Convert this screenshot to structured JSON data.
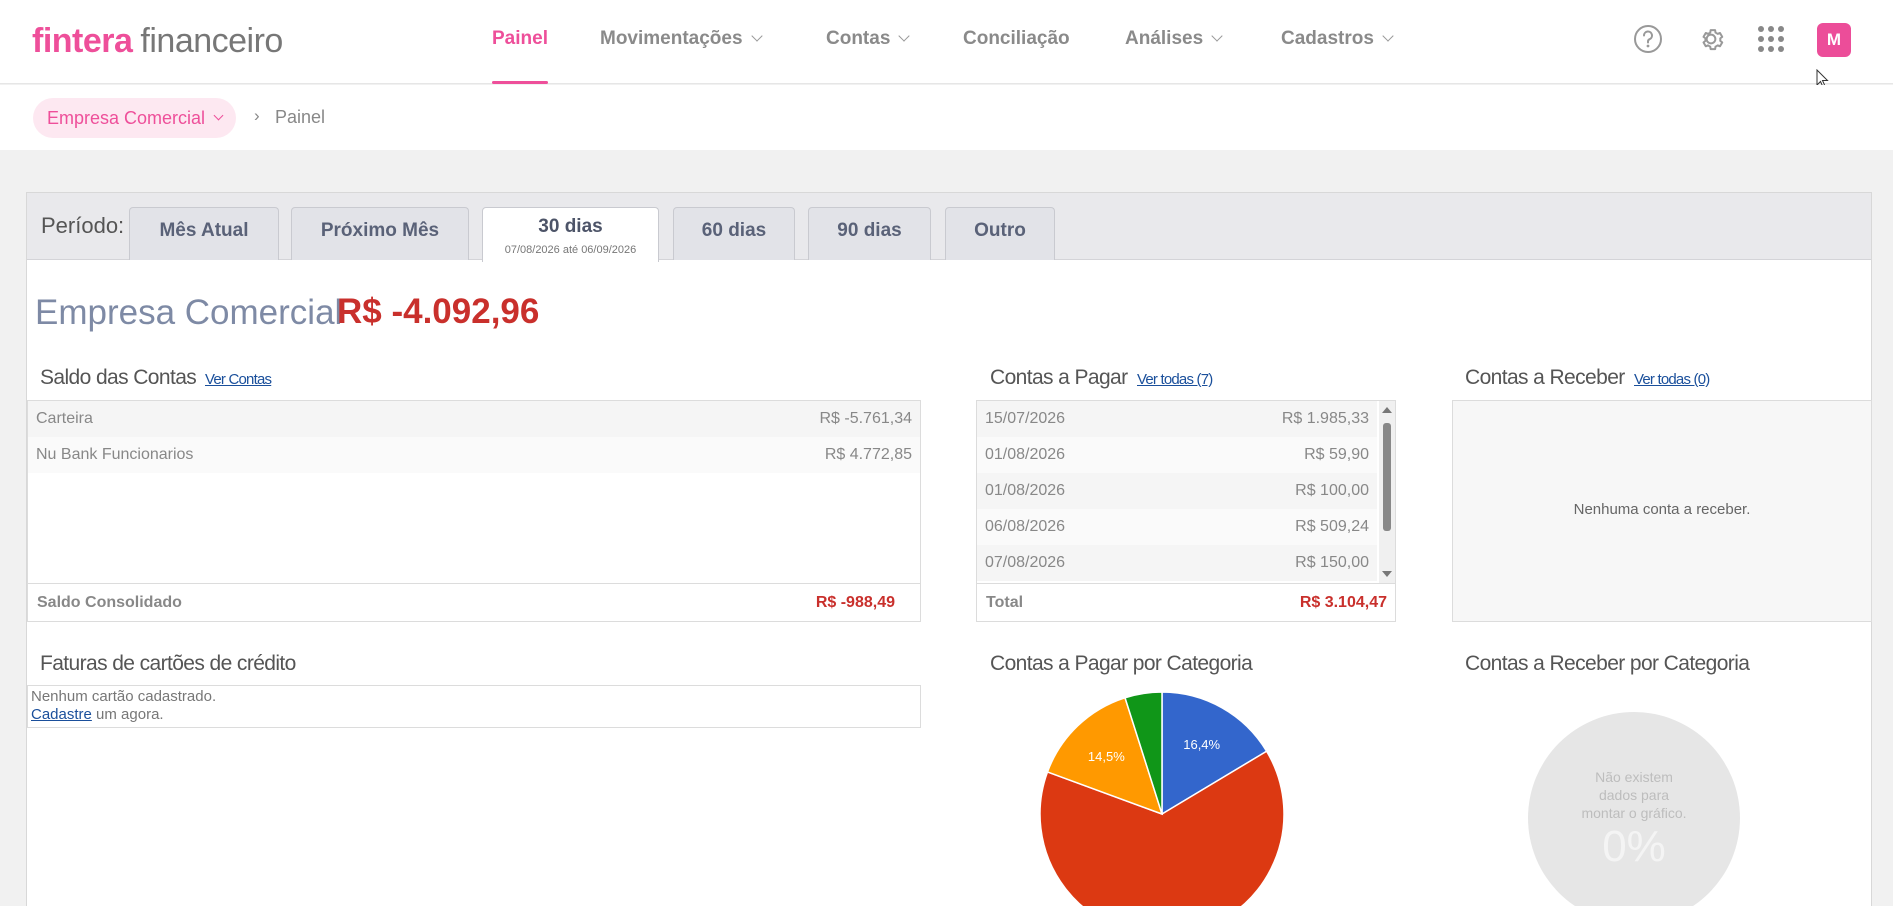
{
  "brand": {
    "name1": "fintera",
    "name2": "financeiro",
    "color": "#ee4f9a"
  },
  "nav": {
    "items": [
      {
        "label": "Painel",
        "active": true,
        "dropdown": false
      },
      {
        "label": "Movimentações",
        "dropdown": true
      },
      {
        "label": "Contas",
        "dropdown": true
      },
      {
        "label": "Conciliação",
        "dropdown": false
      },
      {
        "label": "Análises",
        "dropdown": true
      },
      {
        "label": "Cadastros",
        "dropdown": true
      }
    ],
    "icons": [
      "help-icon",
      "gear-icon",
      "apps-grid-icon"
    ],
    "avatar": "M"
  },
  "breadcrumb": {
    "company": "Empresa Comercial",
    "separator": "›",
    "current": "Painel"
  },
  "period": {
    "label": "Período:",
    "tabs": [
      {
        "label": "Mês Atual"
      },
      {
        "label": "Próximo Mês"
      },
      {
        "label": "30 dias",
        "sub": "07/08/2026 até 06/09/2026",
        "active": true
      },
      {
        "label": "60 dias"
      },
      {
        "label": "90 dias"
      },
      {
        "label": "Outro"
      }
    ]
  },
  "summary": {
    "company": "Empresa Comercial",
    "amount": "R$ -4.092,96"
  },
  "saldo": {
    "title": "Saldo das Contas",
    "link": "Ver Contas",
    "rows": [
      {
        "name": "Carteira",
        "value": "R$ -5.761,34"
      },
      {
        "name": "Nu Bank Funcionarios",
        "value": "R$ 4.772,85"
      }
    ],
    "total_label": "Saldo Consolidado",
    "total_value": "R$ -988,49"
  },
  "pagar": {
    "title": "Contas a Pagar",
    "link": "Ver todas (7)",
    "rows": [
      {
        "date": "15/07/2026",
        "value": "R$ 1.985,33"
      },
      {
        "date": "01/08/2026",
        "value": "R$ 59,90"
      },
      {
        "date": "01/08/2026",
        "value": "R$ 100,00"
      },
      {
        "date": "06/08/2026",
        "value": "R$ 509,24"
      },
      {
        "date": "07/08/2026",
        "value": "R$ 150,00"
      }
    ],
    "total_label": "Total",
    "total_value": "R$ 3.104,47"
  },
  "receber": {
    "title": "Contas a Receber",
    "link": "Ver todas (0)",
    "empty": "Nenhuma conta a receber."
  },
  "faturas": {
    "title": "Faturas de cartões de crédito",
    "empty": "Nenhum cartão cadastrado.",
    "cta_link": "Cadastre",
    "cta_rest": " um agora."
  },
  "pagar_categoria": {
    "title": "Contas a Pagar por Categoria",
    "colors": [
      "#3366cc",
      "#dc3912",
      "#ff9900",
      "#109618"
    ],
    "labels": [
      "16,4%",
      "14,5%"
    ]
  },
  "receber_categoria": {
    "title": "Contas a Receber por Categoria",
    "empty_l1": "Não existem",
    "empty_l2": "dados para",
    "empty_l3": "montar o gráfico.",
    "percent": "0%"
  },
  "chart_data": {
    "type": "pie",
    "categories": [
      "",
      "",
      "",
      ""
    ],
    "values": [
      16.4,
      64.2,
      14.5,
      4.9
    ],
    "colors": [
      "#3366cc",
      "#dc3912",
      "#ff9900",
      "#109618"
    ],
    "data_labels": [
      "16,4%",
      "",
      "14,5%",
      ""
    ],
    "title": "Contas a Pagar por Categoria"
  }
}
